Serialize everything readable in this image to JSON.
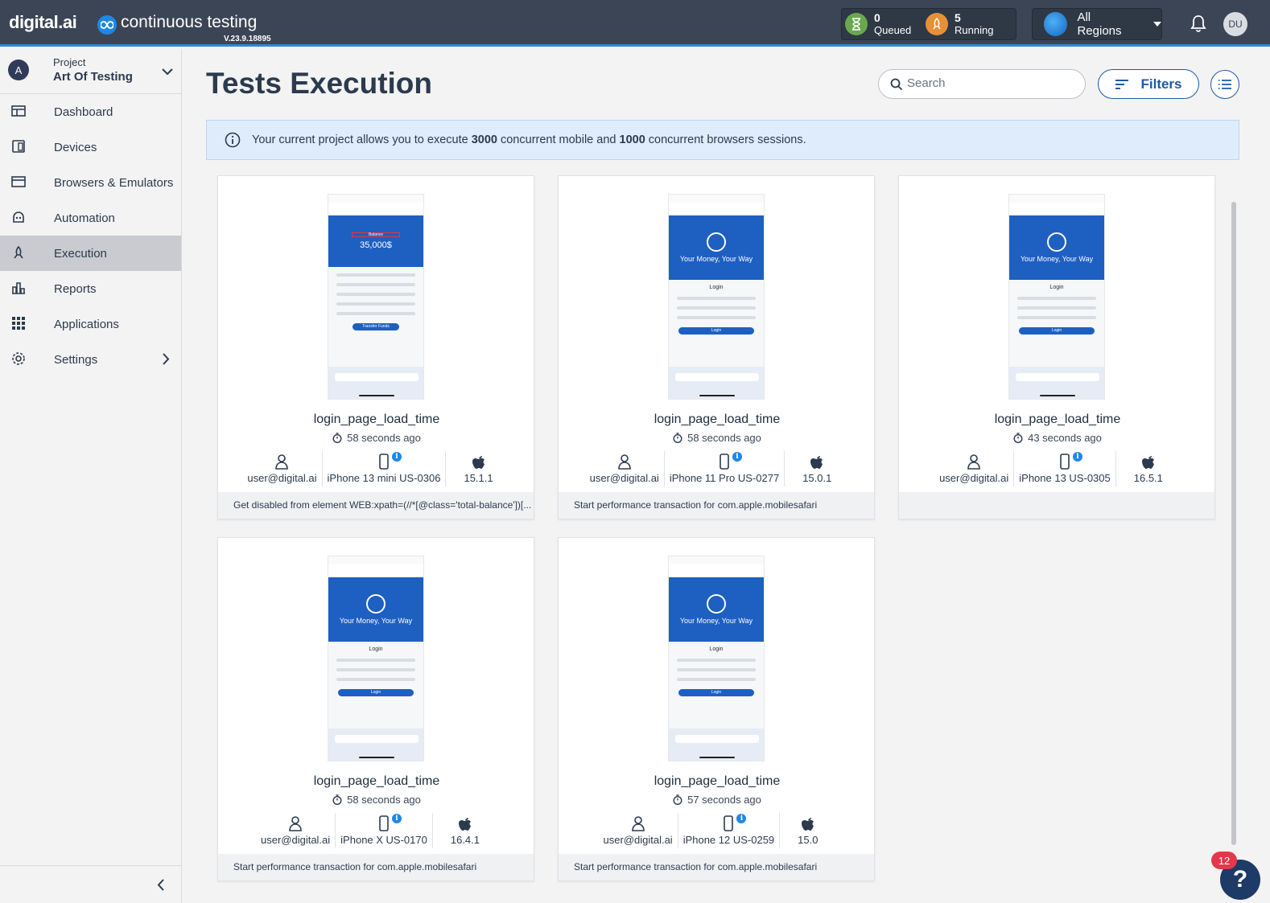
{
  "header": {
    "brand": "digital.ai",
    "product": "continuous testing",
    "version": "V.23.9.18895",
    "queued_count": "0",
    "queued_label": "Queued",
    "running_count": "5",
    "running_label": "Running",
    "region": "All Regions",
    "user_initials": "DU"
  },
  "sidebar": {
    "project_avatar": "A",
    "project_label": "Project",
    "project_name": "Art Of Testing",
    "items": [
      {
        "label": "Dashboard",
        "icon": "dashboard-icon"
      },
      {
        "label": "Devices",
        "icon": "devices-icon"
      },
      {
        "label": "Browsers & Emulators",
        "icon": "browser-icon"
      },
      {
        "label": "Automation",
        "icon": "robot-icon"
      },
      {
        "label": "Execution",
        "icon": "rocket-icon",
        "active": true
      },
      {
        "label": "Reports",
        "icon": "reports-icon"
      },
      {
        "label": "Applications",
        "icon": "grid-icon"
      },
      {
        "label": "Settings",
        "icon": "gear-icon"
      }
    ]
  },
  "main": {
    "title": "Tests Execution",
    "search_placeholder": "Search",
    "filters_label": "Filters",
    "banner": {
      "prefix": "Your current project allows you to execute ",
      "mobile_count": "3000",
      "middle": " concurrent mobile and ",
      "browser_count": "1000",
      "suffix": " concurrent browsers sessions."
    }
  },
  "cards": [
    {
      "name": "login_page_load_time",
      "time": "58 seconds ago",
      "user": "user@digital.ai",
      "device": "iPhone 13 mini US-0306",
      "os": "15.1.1",
      "footer": "Get disabled from element WEB:xpath=(//*[@class='total-balance'])[...",
      "screen": "balance"
    },
    {
      "name": "login_page_load_time",
      "time": "58 seconds ago",
      "user": "user@digital.ai",
      "device": "iPhone 11 Pro US-0277",
      "os": "15.0.1",
      "footer": "Start performance transaction for com.apple.mobilesafari",
      "screen": "login"
    },
    {
      "name": "login_page_load_time",
      "time": "43 seconds ago",
      "user": "user@digital.ai",
      "device": "iPhone 13 US-0305",
      "os": "16.5.1",
      "footer": "",
      "screen": "login"
    },
    {
      "name": "login_page_load_time",
      "time": "58 seconds ago",
      "user": "user@digital.ai",
      "device": "iPhone X US-0170",
      "os": "16.4.1",
      "footer": "Start performance transaction for com.apple.mobilesafari",
      "screen": "login"
    },
    {
      "name": "login_page_load_time",
      "time": "57 seconds ago",
      "user": "user@digital.ai",
      "device": "iPhone 12 US-0259",
      "os": "15.0",
      "footer": "Start performance transaction for com.apple.mobilesafari",
      "screen": "login"
    }
  ],
  "screenshot_text": {
    "hero_login": "Your Money, Your Way",
    "login_heading": "Login",
    "login_button": "Login",
    "balance_label": "Balance",
    "balance_amount": "35,000$",
    "transfer_button": "Transfer Funds"
  },
  "help": {
    "badge": "12",
    "symbol": "?"
  },
  "colors": {
    "topbar": "#3b4555",
    "accent": "#1b5aa6",
    "queued": "#6aa84f",
    "running": "#e69138",
    "badge": "#e5374a"
  }
}
